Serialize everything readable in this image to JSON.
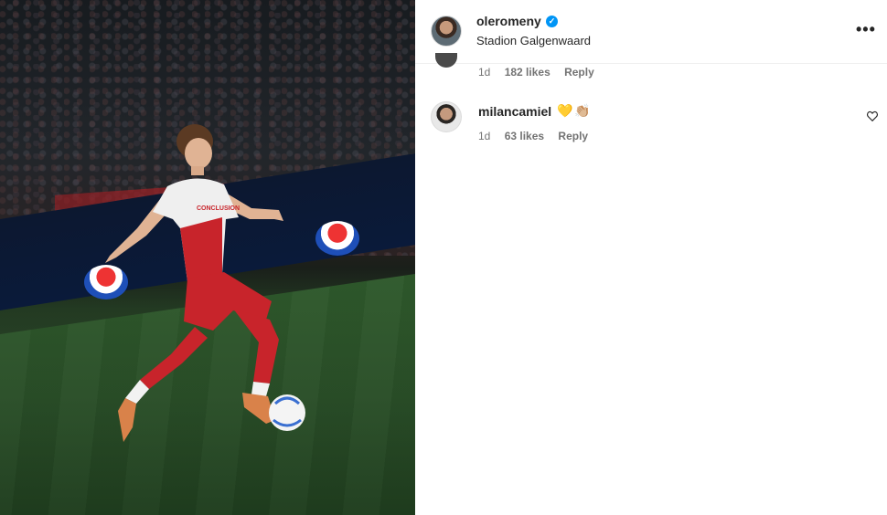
{
  "post": {
    "username": "oleromeny",
    "location": "Stadion Galgenwaard",
    "verified_icon": "✓",
    "more_label": "•••"
  },
  "comments": [
    {
      "time": "1d",
      "likes": "182 likes",
      "reply": "Reply"
    },
    {
      "username": "milancamiel",
      "emojis": [
        "💛",
        "👏🏼"
      ],
      "time": "1d",
      "likes": "63 likes",
      "reply": "Reply",
      "icon": "heart-outline-icon"
    }
  ],
  "photo": {
    "shirt_text": "CONCLUSION",
    "ad_text": "PEPSI"
  },
  "colors": {
    "verified": "#0095f6",
    "text": "#262626",
    "muted": "#737373"
  }
}
